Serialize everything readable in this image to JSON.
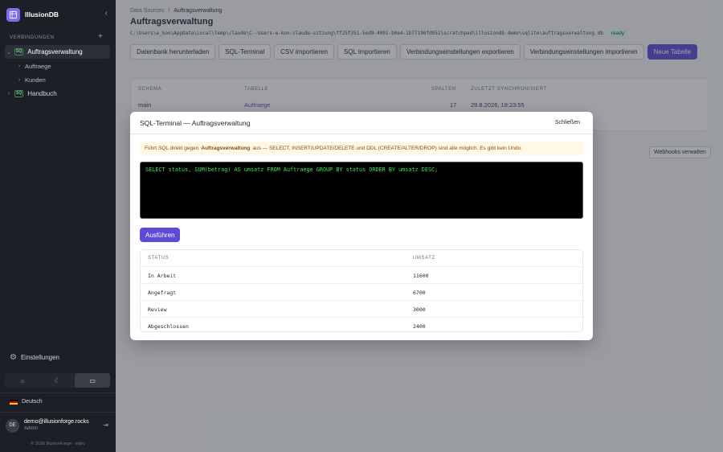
{
  "app": {
    "name": "IllusionDB",
    "footer": "© 2026 IllusionForge · edev"
  },
  "sidebar": {
    "section_label": "Verbindungen",
    "connections": [
      {
        "label": "Auftragsverwaltung",
        "badge": "SQ",
        "expanded": true,
        "active": true
      },
      {
        "label": "Handbuch",
        "badge": "SQ",
        "expanded": false,
        "active": false
      }
    ],
    "sub_items": [
      "Auftraege",
      "Kunden"
    ],
    "settings_label": "Einstellungen",
    "language": "Deutsch",
    "user": {
      "initials": "DE",
      "email": "demo@illusionforge.rocks",
      "role": "Admin"
    }
  },
  "main": {
    "breadcrumb": [
      "Data Sources",
      "/",
      "Auftragsverwaltung"
    ],
    "title": "Auftragsverwaltung",
    "db_path": "C:\\Users\\e_kon\\AppData\\Local\\Temp\\claude\\C--Users-e-kon-claude-sitzung\\ff25f351-5ed9-4091-b0e4-1b77190fd051\\scratchpad\\illusiondb-demo\\sqlite\\auftragsverwaltung.db",
    "status": "ready",
    "toolbar": [
      "Datenbank herunterladen",
      "SQL-Terminal",
      "CSV importieren",
      "SQL importieren",
      "Verbindungseinstellungen exportieren",
      "Verbindungseinstellungen importieren",
      "Neue Tabelle"
    ],
    "tables": {
      "headers": [
        "Schema",
        "Tabelle",
        "Spalten",
        "Zuletzt synchronisiert"
      ],
      "rows": [
        {
          "schema": "main",
          "table": "Auftraege",
          "columns": "17",
          "synced": "29.8.2026, 18:23:55"
        }
      ]
    },
    "webhooks_label": "Webhooks verwalten"
  },
  "modal": {
    "title": "SQL-Terminal — Auftragsverwaltung",
    "close_label": "Schließen",
    "warning_prefix": "Führt SQL direkt gegen",
    "warning_db": "Auftragsverwaltung",
    "warning_suffix": "aus — SELECT, INSERT/UPDATE/DELETE und DDL (CREATE/ALTER/DROP) sind alle möglich. Es gibt kein Undo.",
    "query": "SELECT status, SUM(betrag) AS umsatz FROM Auftraege GROUP BY status ORDER BY umsatz DESC;",
    "run_label": "Ausführen",
    "result": {
      "headers": [
        "status",
        "umsatz"
      ],
      "rows": [
        [
          "In Arbeit",
          "11600"
        ],
        [
          "Angefragt",
          "6700"
        ],
        [
          "Review",
          "3000"
        ],
        [
          "Abgeschlossen",
          "2400"
        ]
      ]
    }
  },
  "colors": {
    "accent": "#5b4bd6",
    "sidebar_bg": "#1c1f26",
    "terminal_text": "#43e25c"
  }
}
